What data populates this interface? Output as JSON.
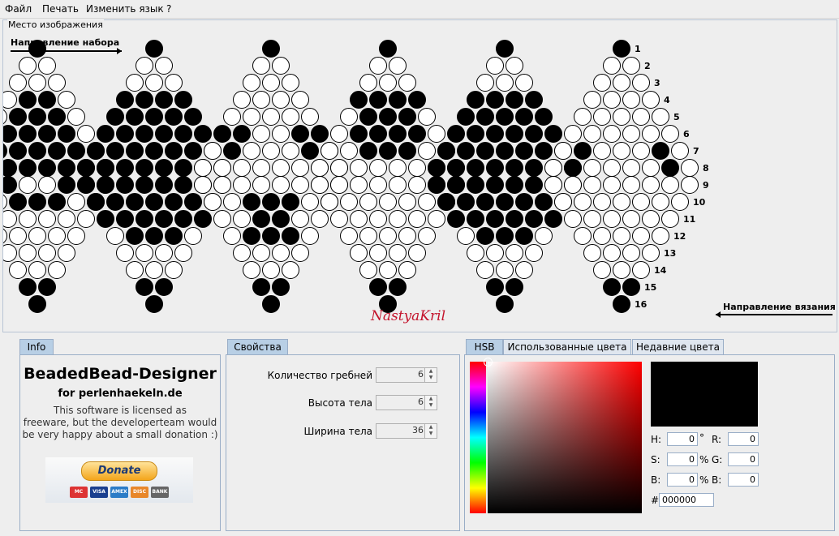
{
  "menu": {
    "file": "Файл",
    "print": "Печать",
    "language": "Изменить язык",
    "help": "?"
  },
  "canvas": {
    "title": "Место изображения",
    "direction_set": "Направление набора",
    "direction_knit": "Направление вязания",
    "watermark": "NastyaKril",
    "row_numbers": [
      "1",
      "2",
      "3",
      "4",
      "5",
      "6",
      "7",
      "8",
      "9",
      "10",
      "11",
      "12",
      "13",
      "14",
      "15",
      "16"
    ],
    "bead_colors": {
      "black": "#000000",
      "white": "#ffffff"
    }
  },
  "info": {
    "tab": "Info",
    "title": "BeadedBead-Designer",
    "subtitle": "for perlenhaekeln.de",
    "text1": "This software is licensed as",
    "text2": "freeware, but the developerteam would",
    "text3": "be very happy about a small donation :)",
    "donate": "Donate",
    "cards": [
      "MC",
      "VISA",
      "AMEX",
      "DISC",
      "BANK"
    ]
  },
  "props": {
    "tab": "Свойства",
    "rows": [
      {
        "label": "Количество гребней",
        "value": "6"
      },
      {
        "label": "Высота тела",
        "value": "6"
      },
      {
        "label": "Ширина тела",
        "value": "36"
      }
    ]
  },
  "color": {
    "tabs": [
      "HSB",
      "Использованные цвета",
      "Недавние цвета"
    ],
    "h": {
      "label": "H:",
      "value": "0",
      "unit": "°"
    },
    "s": {
      "label": "S:",
      "value": "0",
      "unit": "%"
    },
    "b": {
      "label": "B:",
      "value": "0",
      "unit": "%"
    },
    "r": {
      "label": "R:",
      "value": "0"
    },
    "g": {
      "label": "G:",
      "value": "0"
    },
    "bb": {
      "label": "B:",
      "value": "0"
    },
    "hex_label": "#",
    "hex": "000000",
    "selected_color": "#000000"
  }
}
